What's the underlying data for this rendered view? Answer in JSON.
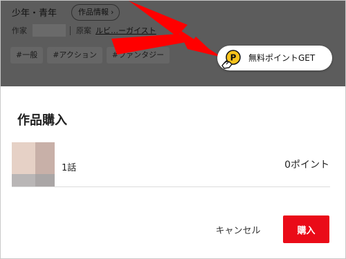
{
  "header": {
    "genre": "少年・青年",
    "info_chip": "作品情報",
    "author_label": "作家",
    "original_label": "原案",
    "original_name": "ルビ…ーガイスト",
    "tags": [
      "#一般",
      "#アクション",
      "#ファンタジー"
    ]
  },
  "points_button": {
    "label": "無料ポイントGET"
  },
  "modal": {
    "title": "作品購入",
    "episode": "1話",
    "price": "0ポイント",
    "cancel_label": "キャンセル",
    "buy_label": "購入"
  },
  "colors": {
    "accent": "#ea0b18",
    "arrow": "#ff0000",
    "coin": "#f7c21b"
  }
}
